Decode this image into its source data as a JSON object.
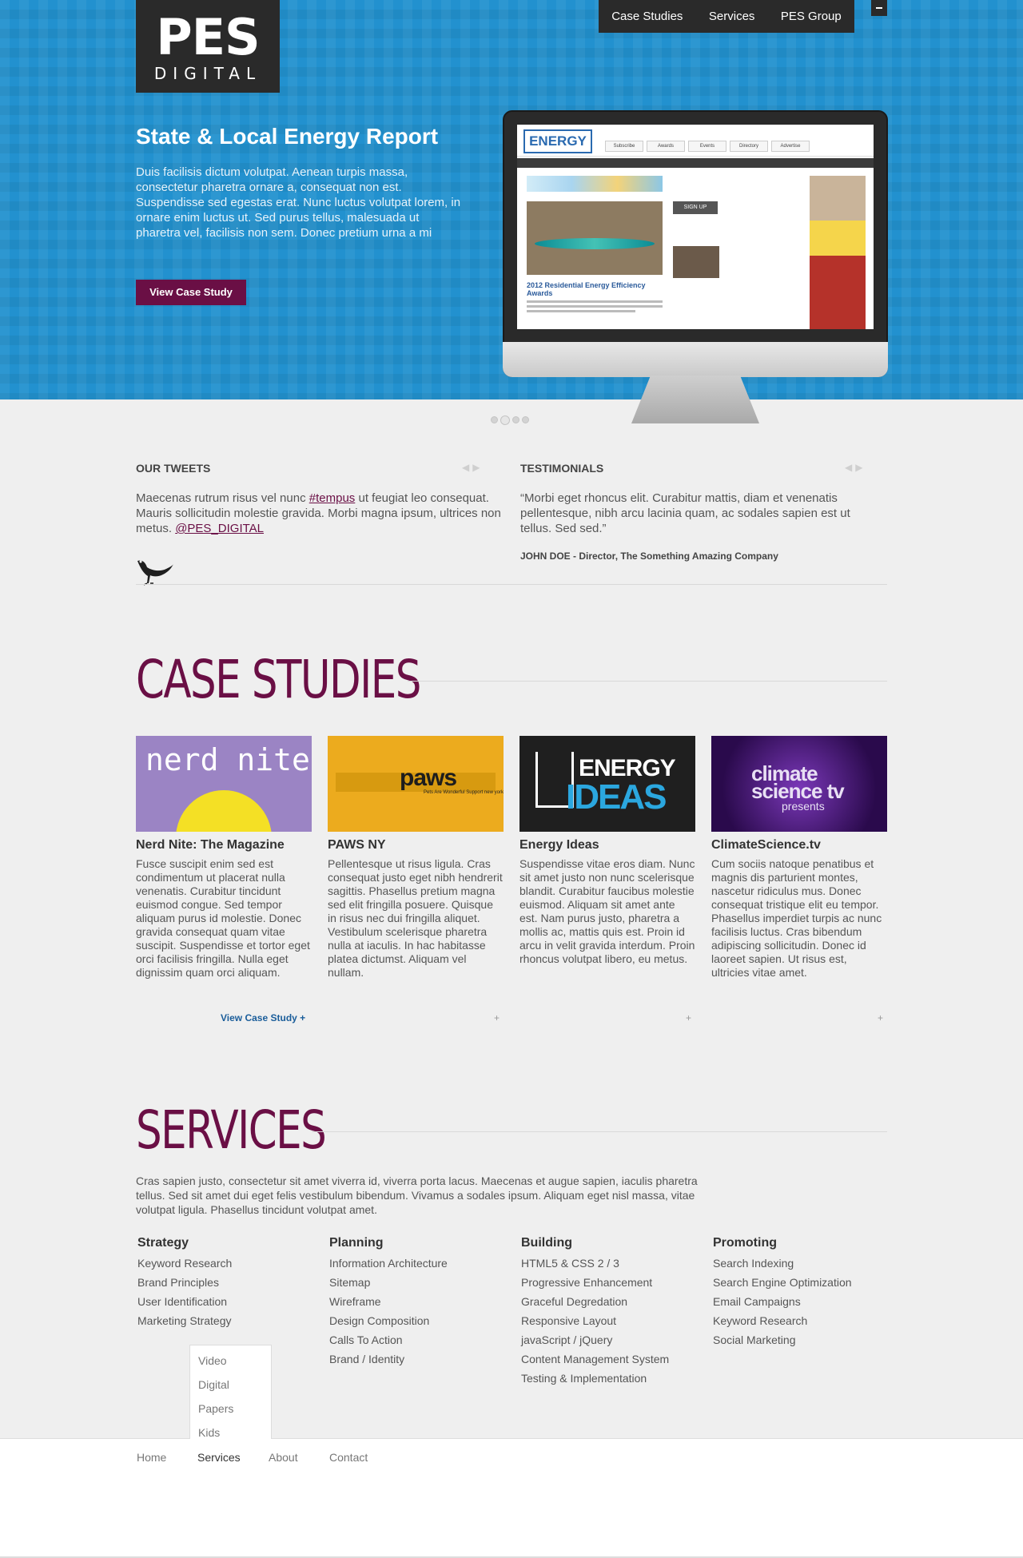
{
  "brand": {
    "logo_big": "PES",
    "logo_small": "DIGITAL"
  },
  "top_nav": [
    "Case Studies",
    "Services",
    "PES Group"
  ],
  "hero": {
    "title": "State & Local Energy Report",
    "body": "Duis facilisis dictum volutpat. Aenean turpis massa, consectetur pharetra ornare a, consequat non est. Suspendisse sed egestas erat. Nunc luctus volutpat lorem, in ornare enim luctus ut. Sed purus tellus, malesuada ut pharetra vel, facilisis non sem. Donec pretium urna a mi",
    "button": "View Case Study",
    "screen": {
      "logo": "ENERGY",
      "tabs": [
        "Subscribe",
        "Awards",
        "Events",
        "Directory",
        "Advertise"
      ],
      "caption": "2012 Residential Energy Efficiency Awards",
      "signup": "SIGN UP"
    },
    "slider_dots": 4,
    "slider_active": 2
  },
  "tweets": {
    "heading": "OUR TWEETS",
    "text_before": "Maecenas rutrum risus vel nunc ",
    "hashtag": "#tempus",
    "text_after": " ut feugiat leo consequat. Mauris sollicitudin molestie gravida. Morbi magna ipsum, ultrices non metus. ",
    "handle": "@PES_DIGITAL",
    "arrows": "◀▶"
  },
  "testimonials": {
    "heading": "TESTIMONIALS",
    "quote": "“Morbi eget rhoncus elit. Curabitur mattis, diam et venenatis pellentesque, nibh arcu lacinia quam, ac sodales sapien est ut tellus. Sed sed.”",
    "author": "JOHN DOE - Director, The Something Amazing Company",
    "arrows": "◀▶"
  },
  "case_studies": {
    "title": "CASE STUDIES",
    "items": [
      {
        "thumb_text": "nerd nite",
        "title": "Nerd Nite: The Magazine",
        "body": "Fusce suscipit enim sed est condimentum ut placerat nulla venenatis. Curabitur tincidunt euismod congue. Sed tempor aliquam purus id molestie. Donec gravida consequat quam vitae suscipit. Suspendisse et tortor eget orci facilisis fringilla. Nulla eget dignissim quam orci aliquam.",
        "link": "View Case Study +"
      },
      {
        "thumb_text": "paws",
        "thumb_sub": "Pets Are Wonderful Support new york",
        "title": "PAWS NY",
        "body": "Pellentesque ut risus ligula. Cras consequat justo eget nibh hendrerit sagittis. Phasellus pretium magna sed elit fringilla posuere. Quisque in risus nec dui fringilla aliquet. Vestibulum scelerisque pharetra nulla at iaculis. In hac habitasse platea dictumst. Aliquam vel nullam.",
        "link": "+"
      },
      {
        "thumb_text": "ENERGY",
        "thumb_text2": "IDEAS",
        "title": "Energy Ideas",
        "body": "Suspendisse vitae eros diam. Nunc sit amet justo non nunc scelerisque blandit. Curabitur faucibus molestie euismod. Aliquam sit amet ante est. Nam purus justo, pharetra a mollis ac, mattis quis est. Proin id arcu in velit gravida interdum. Proin rhoncus volutpat libero, eu metus.",
        "link": "+"
      },
      {
        "thumb_text": "climate science tv",
        "thumb_sub": "presents",
        "title": "ClimateScience.tv",
        "body": "Cum sociis natoque penatibus et magnis dis parturient montes, nascetur ridiculus mus. Donec consequat tristique elit eu tempor. Phasellus imperdiet turpis ac nunc facilisis luctus. Cras bibendum adipiscing sollicitudin. Donec id laoreet sapien. Ut risus est, ultricies vitae amet.",
        "link": "+"
      }
    ]
  },
  "services": {
    "title": "SERVICES",
    "intro": "Cras sapien justo, consectetur sit amet viverra id, viverra porta lacus. Maecenas et augue sapien, iaculis pharetra tellus. Sed sit amet dui eget felis vestibulum bibendum. Vivamus a sodales ipsum. Aliquam eget nisl massa, vitae volutpat ligula. Phasellus tincidunt volutpat amet.",
    "columns": [
      {
        "heading": "Strategy",
        "items": [
          "Keyword Research",
          "Brand Principles",
          "User Identification",
          "Marketing Strategy"
        ]
      },
      {
        "heading": "Planning",
        "items": [
          "Information Architecture",
          "Sitemap",
          "Wireframe",
          "Design Composition",
          "Calls To Action",
          "Brand / Identity"
        ]
      },
      {
        "heading": "Building",
        "items": [
          "HTML5 & CSS 2 / 3",
          "Progressive Enhancement",
          "Graceful Degredation",
          "Responsive Layout",
          "javaScript / jQuery",
          "Content Management System",
          "Testing & Implementation"
        ]
      },
      {
        "heading": "Promoting",
        "items": [
          "Search Indexing",
          "Search Engine Optimization",
          "Email Campaigns",
          "Keyword Research",
          "Social Marketing"
        ]
      }
    ]
  },
  "dropdown": [
    "Video",
    "Digital",
    "Papers",
    "Kids"
  ],
  "footer_nav": [
    "Home",
    "Services",
    "About",
    "Contact"
  ],
  "colors": {
    "accent": "#6a0f45",
    "hero_blue": "#2291cf",
    "dark": "#2a2a2a",
    "link_blue": "#1a5d9a"
  }
}
